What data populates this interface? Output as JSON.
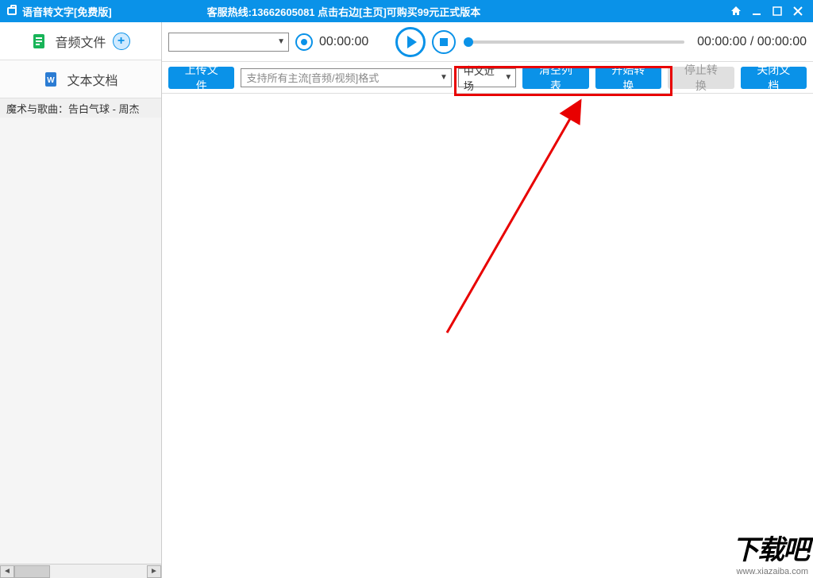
{
  "titlebar": {
    "title": "语音转文字[免费版]",
    "hotline": "客服热线:13662605081  点击右边[主页]可购买99元正式版本"
  },
  "sidebar": {
    "tab_audio": "音频文件",
    "tab_doc": "文本文档",
    "file0": "魔术与歌曲：告白气球 - 周杰"
  },
  "player": {
    "rec_time": "00:00:00",
    "pos_time": "00:00:00 / 00:00:00"
  },
  "toolbar": {
    "upload": "上传文件",
    "format_placeholder": "支持所有主流[音频/视频]格式",
    "lang": "中文近场",
    "clear": "清空列表",
    "start": "开始转换",
    "stop": "停止转换",
    "close": "关闭文档"
  },
  "watermark": {
    "logo_cn": "下载吧",
    "url": "www.xiazaiba.com"
  }
}
